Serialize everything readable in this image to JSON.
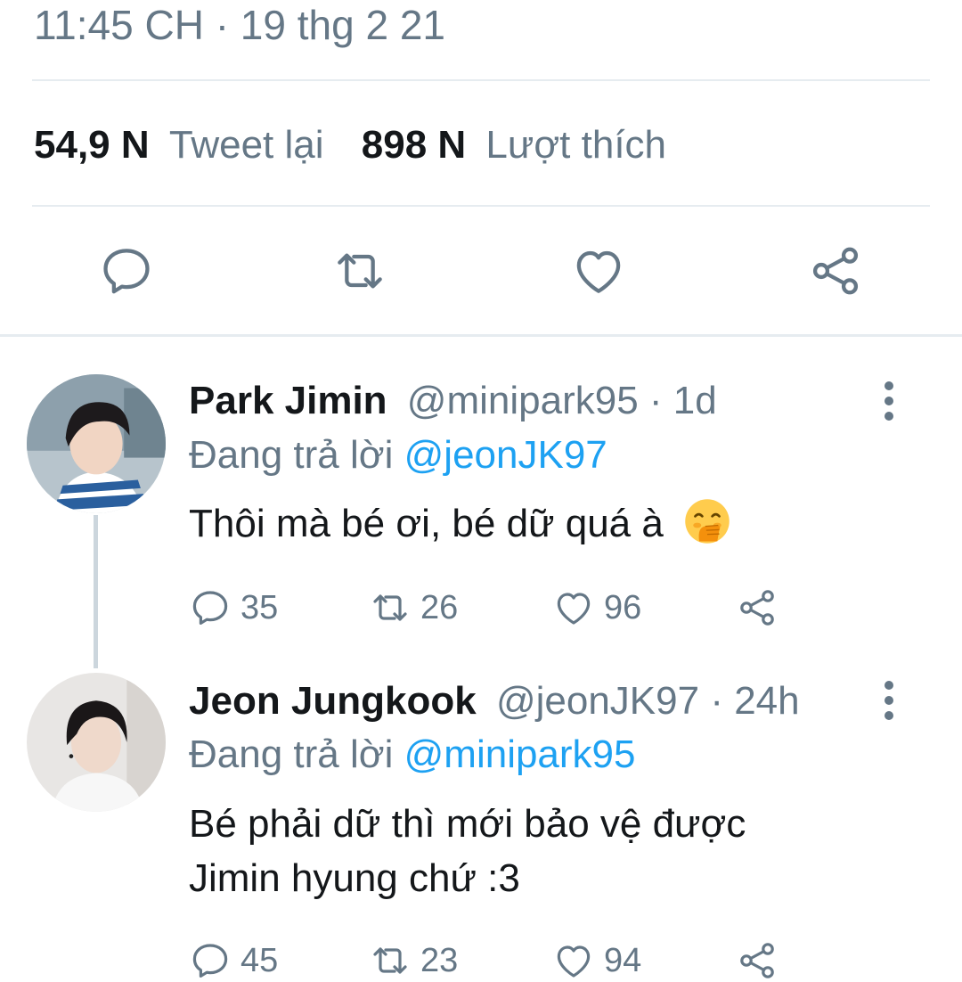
{
  "tweet_meta": {
    "timestamp": "11:45 CH · 19 thg 2 21"
  },
  "stats": {
    "retweets_count": "54,9 N",
    "retweets_label": "Tweet lại",
    "likes_count": "898 N",
    "likes_label": "Lượt thích"
  },
  "actions": [
    "reply-icon",
    "retweet-icon",
    "like-icon",
    "share-icon"
  ],
  "replies": [
    {
      "name": "Park Jimin",
      "handle": "@minipark95 · 1d",
      "reply_prefix": "Đang trả lời ",
      "reply_to": "@jeonJK97",
      "text": "Thôi mà bé ơi, bé dữ quá à",
      "emoji": "face-with-hand-over-mouth-emoji",
      "reply_count": "35",
      "retweet_count": "26",
      "like_count": "96"
    },
    {
      "name": "Jeon Jungkook",
      "handle": "@jeonJK97 · 24h",
      "reply_prefix": "Đang trả lời ",
      "reply_to": "@minipark95",
      "text_line1": "Bé phải dữ thì mới bảo vệ được",
      "text_line2": "Jimin hyung chứ :3",
      "reply_count": "45",
      "retweet_count": "23",
      "like_count": "94"
    }
  ],
  "colors": {
    "accent": "#1da1f2",
    "muted": "#657786",
    "divider": "#e6ecf0"
  }
}
